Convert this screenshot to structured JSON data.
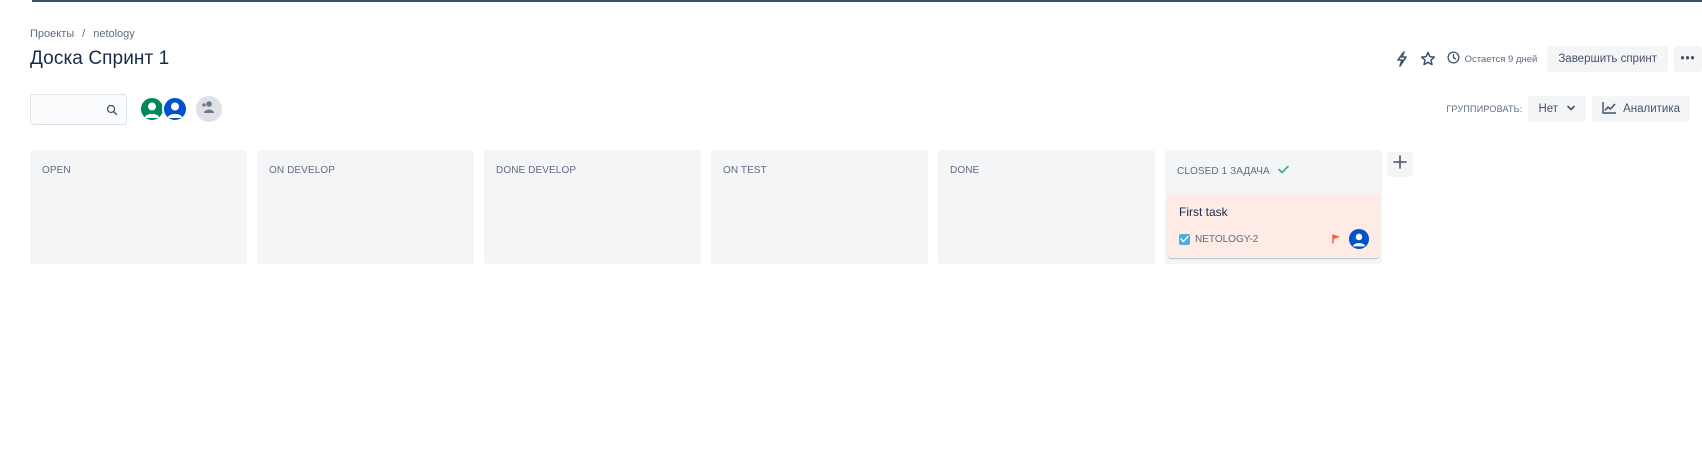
{
  "breadcrumb": {
    "projects": "Проекты",
    "separator": "/",
    "project": "netology"
  },
  "page": {
    "title": "Доска Спринт 1"
  },
  "header": {
    "time_remaining": "Остается 9 дней",
    "complete_sprint_label": "Завершить спринт",
    "more_label": "•••"
  },
  "search": {
    "value": "",
    "placeholder": ""
  },
  "group_by": {
    "label": "ГРУППИРОВАТЬ:",
    "value": "Нет"
  },
  "analytics": {
    "label": "Аналитика"
  },
  "colors": {
    "top_bar": "#42526e",
    "avatar_green": "#00875a",
    "avatar_blue": "#0052cc",
    "card_bg": "#ffebe6",
    "priority_flag": "#ff5630",
    "story_check": "#4bade8",
    "done_check": "#36b37e"
  },
  "columns": [
    {
      "name": "OPEN"
    },
    {
      "name": "ON DEVELOP"
    },
    {
      "name": "DONE DEVELOP"
    },
    {
      "name": "ON TEST"
    },
    {
      "name": "DONE"
    },
    {
      "name": "CLOSED 1 ЗАДАЧА",
      "done_icon": "check-icon"
    }
  ],
  "card": {
    "title": "First task",
    "key": "NETOLOGY-2",
    "type_icon": "checkbox-task-icon",
    "priority_icon": "flag-icon"
  }
}
